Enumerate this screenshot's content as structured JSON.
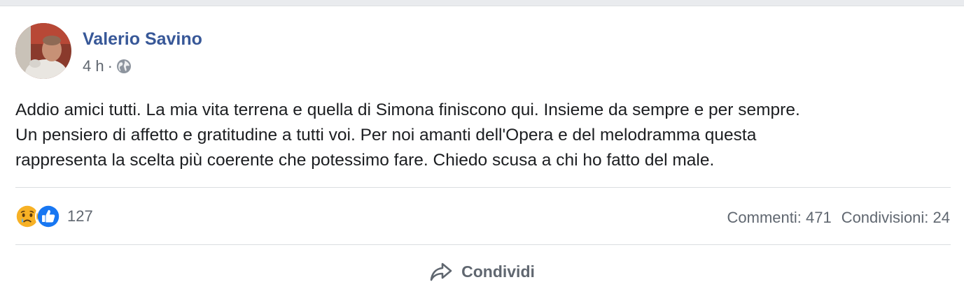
{
  "post": {
    "author": "Valerio Savino",
    "time": "4 h",
    "separator": "·",
    "privacy_icon": "globe-icon",
    "text_lines": [
      "Addio amici tutti. La mia vita terrena e quella di Simona finiscono qui. Insieme da sempre e per sempre.",
      "Un pensiero di affetto e gratitudine a tutti voi. Per noi amanti dell'Opera e del melodramma questa",
      "rappresenta la scelta più coerente che potessimo fare. Chiedo scusa a chi ho fatto del male."
    ]
  },
  "reactions": {
    "icons": [
      "sad-face-icon",
      "like-icon"
    ],
    "count": "127"
  },
  "stats": {
    "comments": "Commenti: 471",
    "shares": "Condivisioni: 24"
  },
  "actions": {
    "share_label": "Condividi",
    "share_icon": "share-arrow-icon"
  },
  "colors": {
    "author_link": "#385898",
    "text": "#1c1e21",
    "secondary_text": "#606770",
    "like_blue": "#1877f2",
    "sad_yellow": "#f7b125"
  }
}
